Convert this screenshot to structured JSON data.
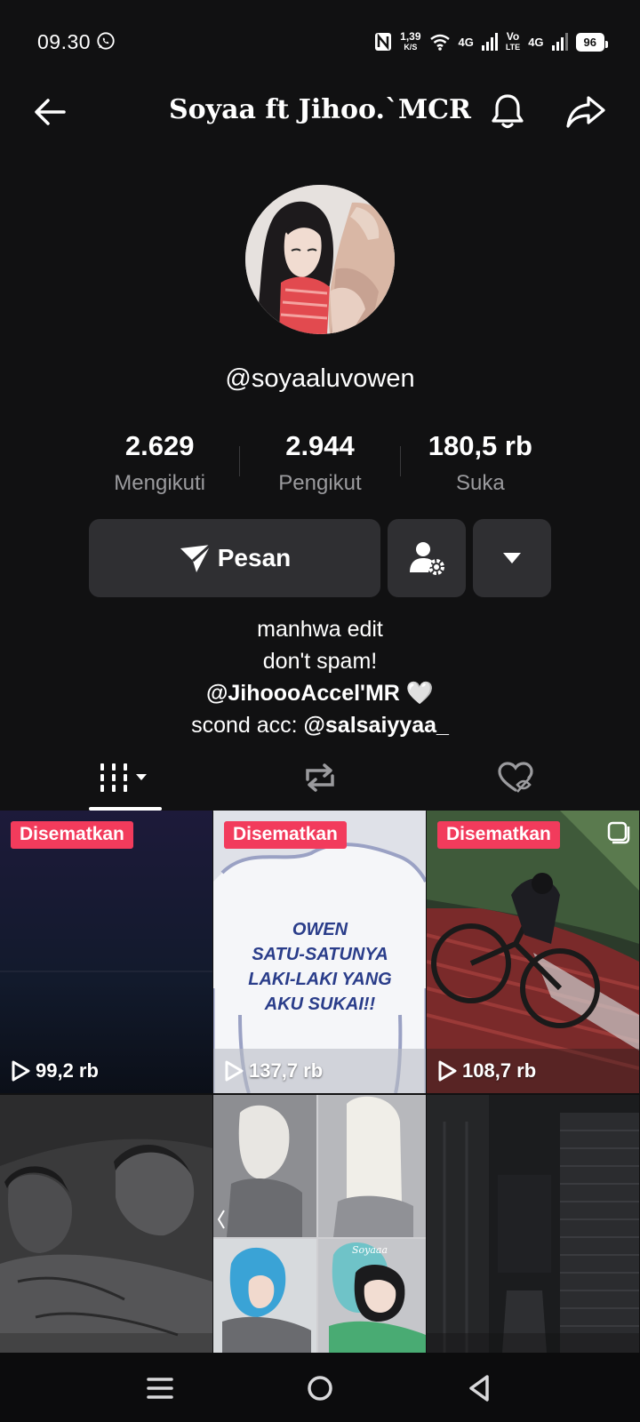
{
  "status_bar": {
    "time": "09.30",
    "net_speed_value": "1,39",
    "net_speed_unit": "K/S",
    "network_1": "4G",
    "network_2_top": "Vo",
    "network_2_bottom": "LTE",
    "network_3": "4G",
    "battery": "96"
  },
  "header": {
    "title": "Soyaa ft Jihoo.`MCR"
  },
  "profile": {
    "username": "@soyaaluvowen",
    "stats": [
      {
        "value": "2.629",
        "label": "Mengikuti"
      },
      {
        "value": "2.944",
        "label": "Pengikut"
      },
      {
        "value": "180,5 rb",
        "label": "Suka"
      }
    ],
    "message_button": "Pesan",
    "bio": {
      "line1": "manhwa edit",
      "line2": "don't spam!",
      "line3": "@JihoooAccel'MR",
      "line3_emoji": "🤍",
      "line4_prefix": "scond acc: ",
      "line4_handle": "@salsaiyyaa_"
    }
  },
  "videos": [
    {
      "badge": "Disematkan",
      "views": "99,2 rb"
    },
    {
      "badge": "Disematkan",
      "views": "137,7 rb",
      "art_text": [
        "OWEN",
        "SATU-SATUNYA",
        "LAKI-LAKI YANG",
        "AKU SUKAI!!"
      ]
    },
    {
      "badge": "Disematkan",
      "views": "108,7 rb"
    },
    {
      "watermark": "Soyaaa"
    }
  ],
  "colors": {
    "background": "#111112",
    "badge": "#f23b5c",
    "button": "#2f2f32",
    "muted_text": "#9b9b9e"
  }
}
